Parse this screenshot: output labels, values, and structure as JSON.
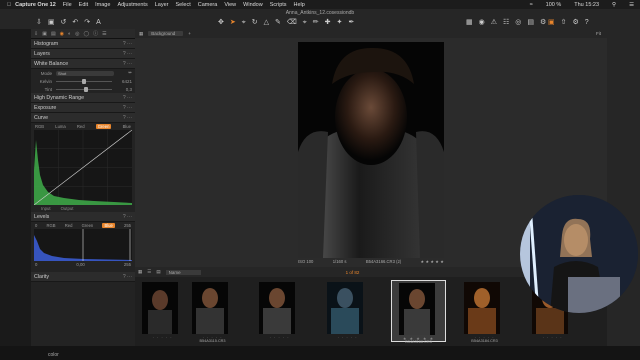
{
  "menubar": {
    "app": "Capture One 12",
    "items": [
      "File",
      "Edit",
      "Image",
      "Adjustments",
      "Layer",
      "Select",
      "Camera",
      "View",
      "Window",
      "Scripts",
      "Help"
    ],
    "battery": "100 %",
    "clock": "Thu 15:23"
  },
  "toolbar": {
    "doc_title": "Anna_Antkins_12.cosessiondb"
  },
  "tool_tab_icons": [
    "import-icon",
    "camera-icon",
    "library-icon",
    "color-icon",
    "exposure-icon",
    "details-icon",
    "lens-icon",
    "meta-icon",
    "batch-icon"
  ],
  "panel": {
    "histogram": "Histogram",
    "layers": "Layers",
    "white_balance": {
      "title": "White Balance",
      "mode_label": "Mode",
      "mode_value": "Shot",
      "kelvin_label": "Kelvin",
      "kelvin_value": "6421",
      "tint_label": "Tint",
      "tint_value": "0,3"
    },
    "hdr": "High Dynamic Range",
    "exposure": "Exposure",
    "curve": {
      "title": "Curve",
      "channels": [
        "RGB",
        "Luma",
        "Red",
        "Green",
        "Blue"
      ],
      "active_channel": "Green",
      "input_label": "Input",
      "output_label": "Output"
    },
    "levels": {
      "title": "Levels",
      "channels": [
        "RGB",
        "Red",
        "Green",
        "Blue"
      ],
      "active_channel": "Blue",
      "left_top": "0",
      "right_top": "255",
      "low": "0",
      "mid": "0,00",
      "high": "255"
    },
    "clarity": "Clarity"
  },
  "viewer": {
    "layer_select": "Background",
    "fit": "Fit",
    "iso": "ISO 100",
    "shutter": "1/160 s",
    "filename": "B54A3166.CR3 (2)",
    "stars": "★ ★ ★ ★ ★"
  },
  "filmbar": {
    "sort": "Name",
    "count": "1 of 82",
    "search_placeholder": "Search"
  },
  "thumbnails": [
    {
      "name": "",
      "selected": false
    },
    {
      "name": "B54A3115.CR3",
      "selected": false
    },
    {
      "name": "",
      "selected": false
    },
    {
      "name": "",
      "selected": false
    },
    {
      "name": "B54A3166.CR3",
      "selected": true
    },
    {
      "name": "B54A3184.CR3",
      "selected": false
    },
    {
      "name": "",
      "selected": false
    }
  ],
  "bottombar": {
    "label": "color"
  },
  "colors": {
    "accent": "#e8852c",
    "curve_green": "#3fae4a",
    "levels_blue": "#3a5bd0"
  }
}
